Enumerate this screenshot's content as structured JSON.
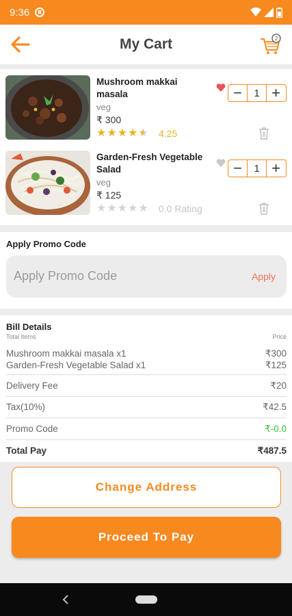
{
  "status_bar": {
    "time": "9:36",
    "notification_icon": "r-circle-icon",
    "icons": [
      "wifi-icon",
      "signal-icon",
      "battery-icon"
    ]
  },
  "header": {
    "title": "My Cart",
    "back_icon": "arrow-left-icon",
    "cart_icon": "cart-icon"
  },
  "cart_items": [
    {
      "name": "Mushroom makkai masala",
      "type": "veg",
      "price": "₹ 300",
      "stars_filled": 4.5,
      "rating": "4.25",
      "liked": true,
      "quantity": "1"
    },
    {
      "name": "Garden-Fresh Vegetable Salad",
      "type": "veg",
      "price": "₹ 125",
      "stars_filled": 0,
      "rating": "0.0 Rating",
      "liked": false,
      "quantity": "1"
    }
  ],
  "promo": {
    "label": "Apply Promo Code",
    "placeholder": "Apply Promo Code",
    "apply_label": "Apply"
  },
  "bill": {
    "title": "Bill Details",
    "col_left": "Total Items",
    "col_right": "Price",
    "lines": [
      {
        "label": "Mushroom makkai masala  x1",
        "value": "₹300"
      },
      {
        "label": "Garden-Fresh Vegetable Salad  x1",
        "value": "₹125"
      }
    ],
    "delivery_label": "Delivery Fee",
    "delivery_value": "₹20",
    "tax_label": "Tax(10%)",
    "tax_value": "₹42.5",
    "promo_label": "Promo Code",
    "promo_value": "₹-0.0",
    "total_label": "Total Pay",
    "total_value": "₹487.5"
  },
  "buttons": {
    "change_address": "Change Address",
    "proceed": "Proceed To Pay"
  },
  "colors": {
    "accent": "#f7891f",
    "heart": "#e8505b",
    "star": "#e6b422",
    "promo_green": "#35c435"
  }
}
